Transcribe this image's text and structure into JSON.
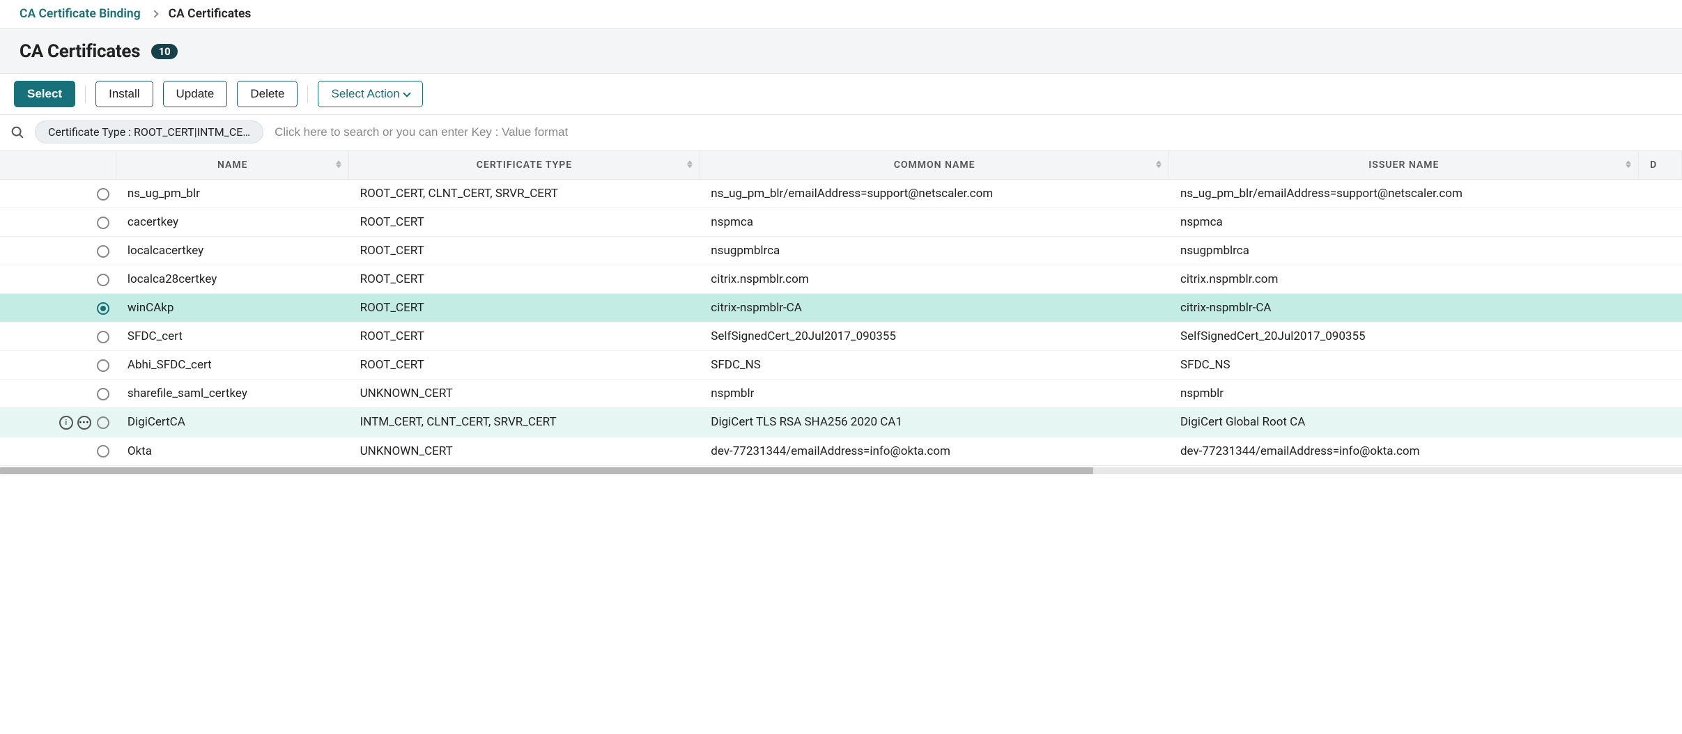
{
  "breadcrumb": {
    "parent": "CA Certificate Binding",
    "current": "CA Certificates"
  },
  "title": "CA Certificates",
  "count": "10",
  "toolbar": {
    "select": "Select",
    "install": "Install",
    "update": "Update",
    "delete": "Delete",
    "action": "Select Action"
  },
  "filter": {
    "label": "Certificate Type : ROOT_CERT|INTM_CE…"
  },
  "search": {
    "placeholder": "Click here to search or you can enter Key : Value format"
  },
  "columns": {
    "name": "NAME",
    "type": "CERTIFICATE TYPE",
    "common": "COMMON NAME",
    "issuer": "ISSUER NAME",
    "days": "D"
  },
  "rows": [
    {
      "selected": false,
      "hover": false,
      "name": "ns_ug_pm_blr",
      "type": "ROOT_CERT, CLNT_CERT, SRVR_CERT",
      "common": "ns_ug_pm_blr/emailAddress=support@netscaler.com",
      "issuer": "ns_ug_pm_blr/emailAddress=support@netscaler.com"
    },
    {
      "selected": false,
      "hover": false,
      "name": "cacertkey",
      "type": "ROOT_CERT",
      "common": "nspmca",
      "issuer": "nspmca"
    },
    {
      "selected": false,
      "hover": false,
      "name": "localcacertkey",
      "type": "ROOT_CERT",
      "common": "nsugpmblrca",
      "issuer": "nsugpmblrca"
    },
    {
      "selected": false,
      "hover": false,
      "name": "localca28certkey",
      "type": "ROOT_CERT",
      "common": "citrix.nspmblr.com",
      "issuer": "citrix.nspmblr.com"
    },
    {
      "selected": true,
      "hover": false,
      "name": "winCAkp",
      "type": "ROOT_CERT",
      "common": "citrix-nspmblr-CA",
      "issuer": "citrix-nspmblr-CA"
    },
    {
      "selected": false,
      "hover": false,
      "name": "SFDC_cert",
      "type": "ROOT_CERT",
      "common": "SelfSignedCert_20Jul2017_090355",
      "issuer": "SelfSignedCert_20Jul2017_090355"
    },
    {
      "selected": false,
      "hover": false,
      "name": "Abhi_SFDC_cert",
      "type": "ROOT_CERT",
      "common": "SFDC_NS",
      "issuer": "SFDC_NS"
    },
    {
      "selected": false,
      "hover": false,
      "name": "sharefile_saml_certkey",
      "type": "UNKNOWN_CERT",
      "common": "nspmblr",
      "issuer": "nspmblr"
    },
    {
      "selected": false,
      "hover": true,
      "name": "DigiCertCA",
      "type": "INTM_CERT, CLNT_CERT, SRVR_CERT",
      "common": "DigiCert TLS RSA SHA256 2020 CA1",
      "issuer": "DigiCert Global Root CA"
    },
    {
      "selected": false,
      "hover": false,
      "name": "Okta",
      "type": "UNKNOWN_CERT",
      "common": "dev-77231344/emailAddress=info@okta.com",
      "issuer": "dev-77231344/emailAddress=info@okta.com"
    }
  ]
}
